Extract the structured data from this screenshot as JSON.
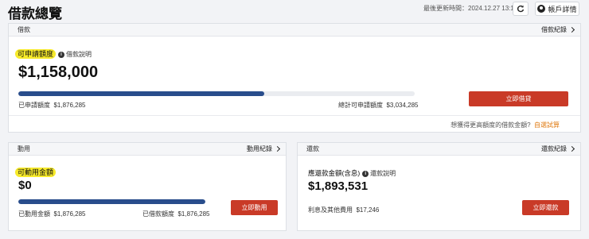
{
  "header": {
    "title": "借款總覽",
    "updated": "最後更新時間：2024.12.27 13:17",
    "account_label": "帳戶詳情"
  },
  "loan": {
    "section_label": "借款",
    "records_link": "借款紀錄",
    "available_label": "可申請額度",
    "explain_label": "借款說明",
    "available_amount": "$1,158,000",
    "progress": 0.62,
    "applied_label": "已申請額度",
    "applied_value": "$1,876,285",
    "total_label": "總計可申請額度",
    "total_value": "$3,034,285",
    "borrow_button": "立即借貸",
    "promo_question": "想獲得更高額度的借款金額?",
    "promo_link": "自選試算"
  },
  "usage": {
    "section_label": "動用",
    "records_link": "動用紀錄",
    "available_label": "可動用金額",
    "available_amount": "$0",
    "progress": 1.0,
    "used_label": "已動用金額",
    "used_value": "$1,876,285",
    "borrowed_label": "已借款額度",
    "borrowed_value": "$1,876,285",
    "use_button": "立即動用"
  },
  "repay": {
    "section_label": "還款",
    "records_link": "還款紀錄",
    "due_label": "應還款金額(含息)",
    "explain_label": "還款說明",
    "due_amount": "$1,893,531",
    "interest_label": "利息及其他費用",
    "interest_value": "$17,246",
    "repay_button": "立即還款"
  },
  "colors": {
    "accent_red": "#c93a27",
    "progress_blue": "#294d8c",
    "highlight_yellow": "#f7ea2a",
    "link_orange": "#e07a10"
  }
}
